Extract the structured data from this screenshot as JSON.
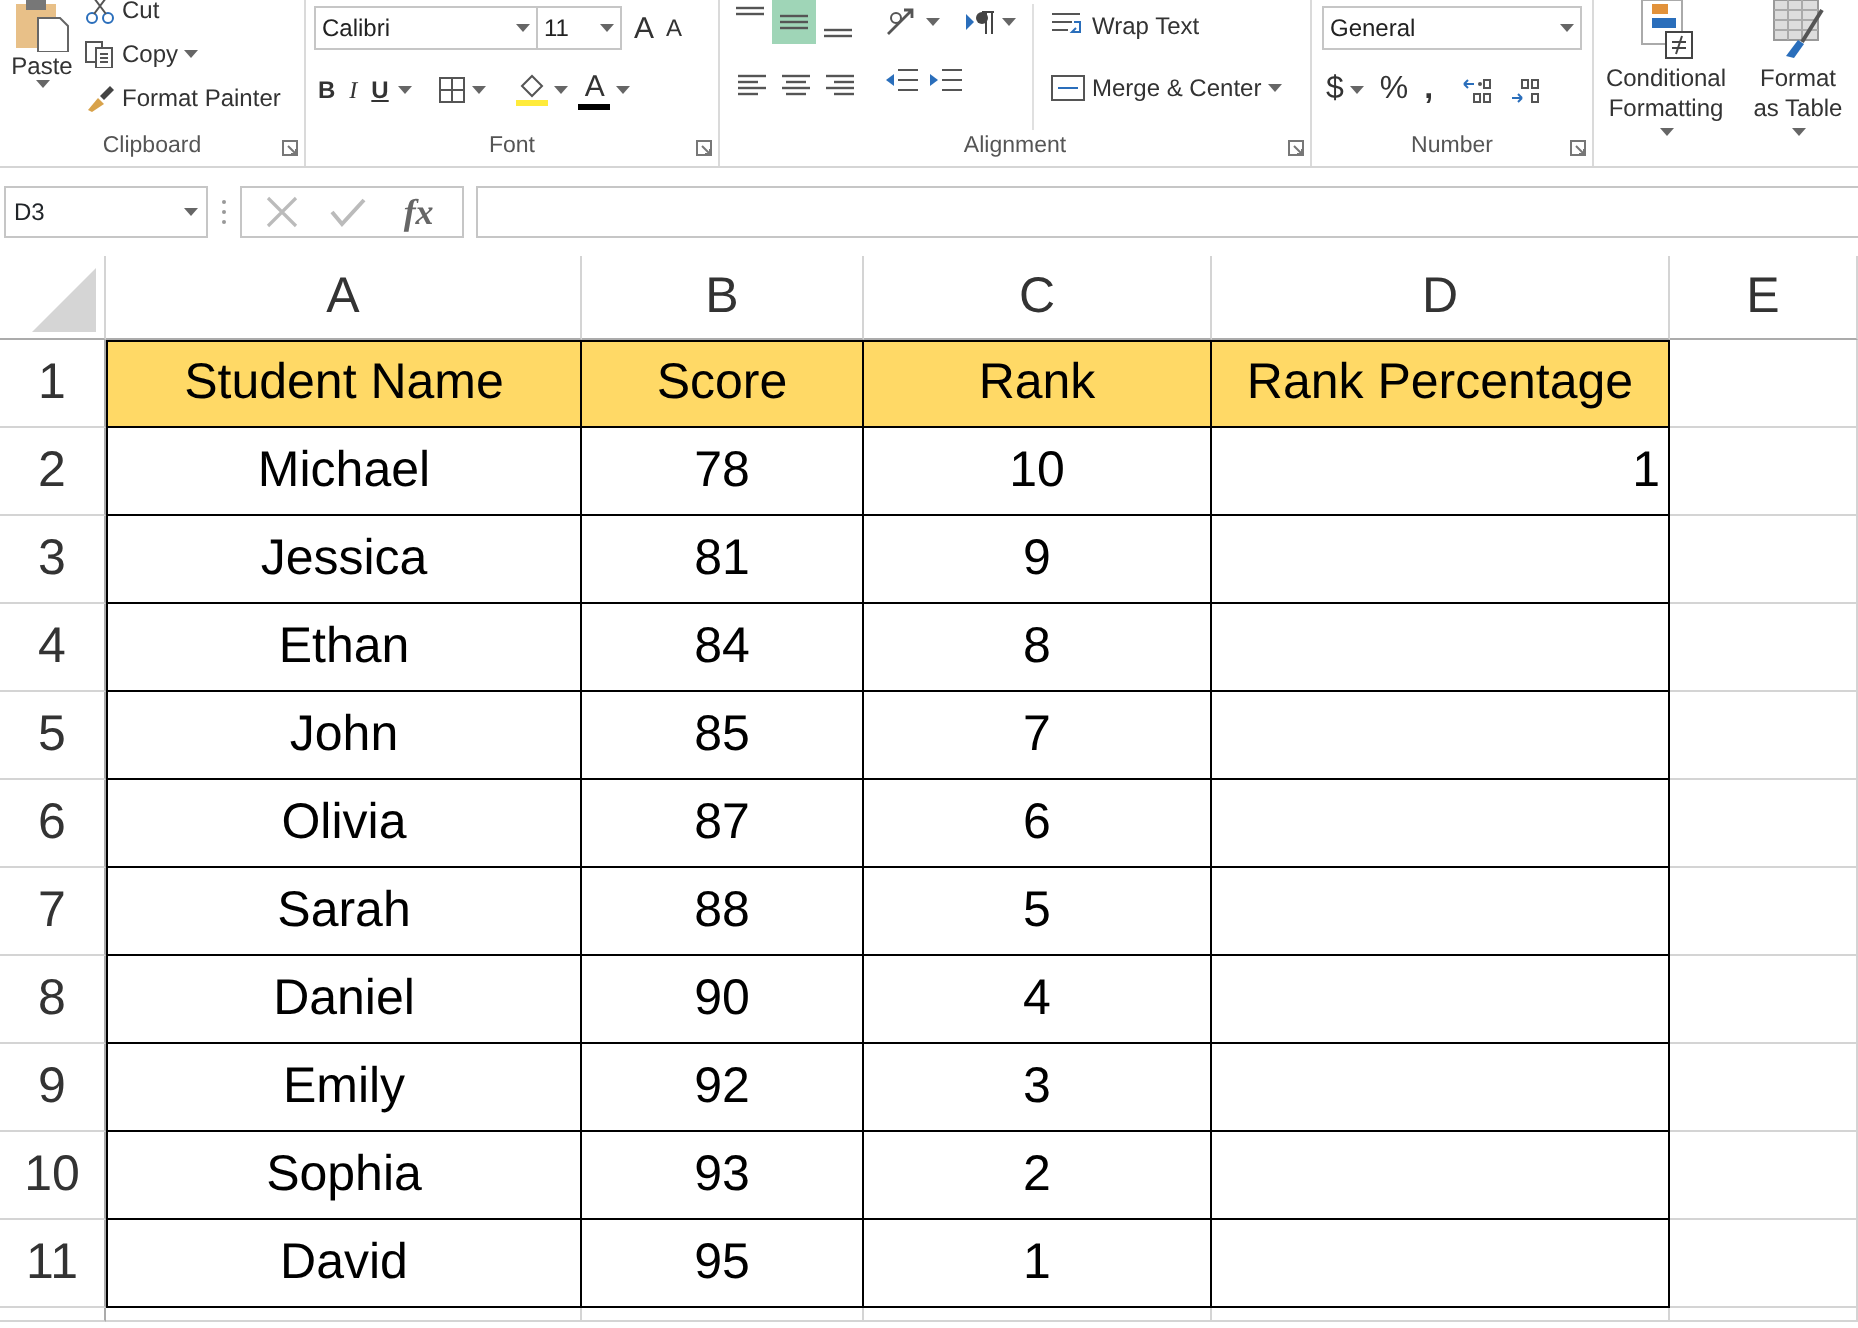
{
  "ribbon": {
    "clipboard": {
      "paste": "Paste",
      "cut": "Cut",
      "copy": "Copy",
      "format_painter": "Format Painter",
      "label": "Clipboard"
    },
    "font": {
      "font_name": "Calibri",
      "font_size": "11",
      "grow": "A",
      "shrink": "A",
      "bold": "B",
      "italic": "I",
      "underline": "U",
      "font_color": "A",
      "label": "Font"
    },
    "alignment": {
      "buttons": [
        {
          "kind": "top",
          "selected": false
        },
        {
          "kind": "middle",
          "selected": true
        },
        {
          "kind": "bottom",
          "selected": false
        },
        {
          "kind": "left",
          "selected": false
        },
        {
          "kind": "center",
          "selected": false
        },
        {
          "kind": "right",
          "selected": false
        }
      ],
      "wrap_text": "Wrap Text",
      "merge_center": "Merge & Center",
      "label": "Alignment"
    },
    "number": {
      "format": "General",
      "currency": "$",
      "percent": "%",
      "comma": ",",
      "label": "Number"
    },
    "styles": {
      "conditional_formatting": "Conditional Formatting",
      "format_as_table": "Format as Table"
    }
  },
  "formula_bar": {
    "name_box": "D3",
    "function_label": "fx"
  },
  "sheet": {
    "columns": [
      "A",
      "B",
      "C",
      "D",
      "E"
    ],
    "rows": [
      {
        "number": "1",
        "header": true,
        "cells": [
          "Student Name",
          "Score",
          "Rank",
          "Rank Percentage"
        ]
      },
      {
        "number": "2",
        "header": false,
        "cells": [
          "Michael",
          "78",
          "10",
          "1"
        ]
      },
      {
        "number": "3",
        "header": false,
        "cells": [
          "Jessica",
          "81",
          "9",
          ""
        ]
      },
      {
        "number": "4",
        "header": false,
        "cells": [
          "Ethan",
          "84",
          "8",
          ""
        ]
      },
      {
        "number": "5",
        "header": false,
        "cells": [
          "John",
          "85",
          "7",
          ""
        ]
      },
      {
        "number": "6",
        "header": false,
        "cells": [
          "Olivia",
          "87",
          "6",
          ""
        ]
      },
      {
        "number": "7",
        "header": false,
        "cells": [
          "Sarah",
          "88",
          "5",
          ""
        ]
      },
      {
        "number": "8",
        "header": false,
        "cells": [
          "Daniel",
          "90",
          "4",
          ""
        ]
      },
      {
        "number": "9",
        "header": false,
        "cells": [
          "Emily",
          "92",
          "3",
          ""
        ]
      },
      {
        "number": "10",
        "header": false,
        "cells": [
          "Sophia",
          "93",
          "2",
          ""
        ]
      },
      {
        "number": "11",
        "header": false,
        "cells": [
          "David",
          "95",
          "1",
          ""
        ]
      }
    ]
  }
}
